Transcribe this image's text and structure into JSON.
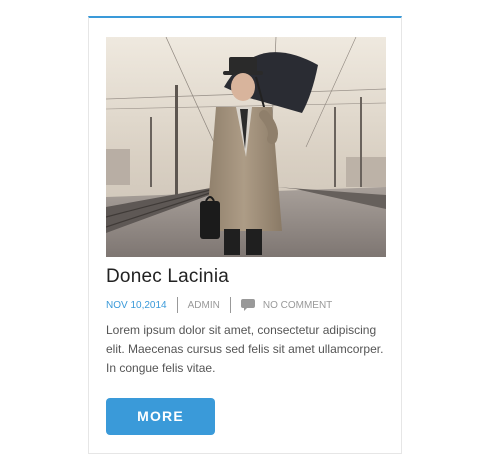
{
  "post": {
    "title": "Donec Lacinia",
    "date": "NOV 10,2014",
    "author": "ADMIN",
    "comments": "NO COMMENT",
    "excerpt": "Lorem ipsum dolor sit amet, consectetur adipiscing elit. Maecenas cursus sed felis sit amet ullamcorper. In congue felis vitae.",
    "more_label": "MORE",
    "image_alt": "Man in trench coat holding an umbrella on a rainy train platform",
    "comment_icon": "speech-bubble-icon"
  },
  "colors": {
    "accent": "#3a9ad9",
    "title": "#222222",
    "meta": "#999999",
    "body_text": "#555555",
    "border": "#e6e6e6"
  }
}
